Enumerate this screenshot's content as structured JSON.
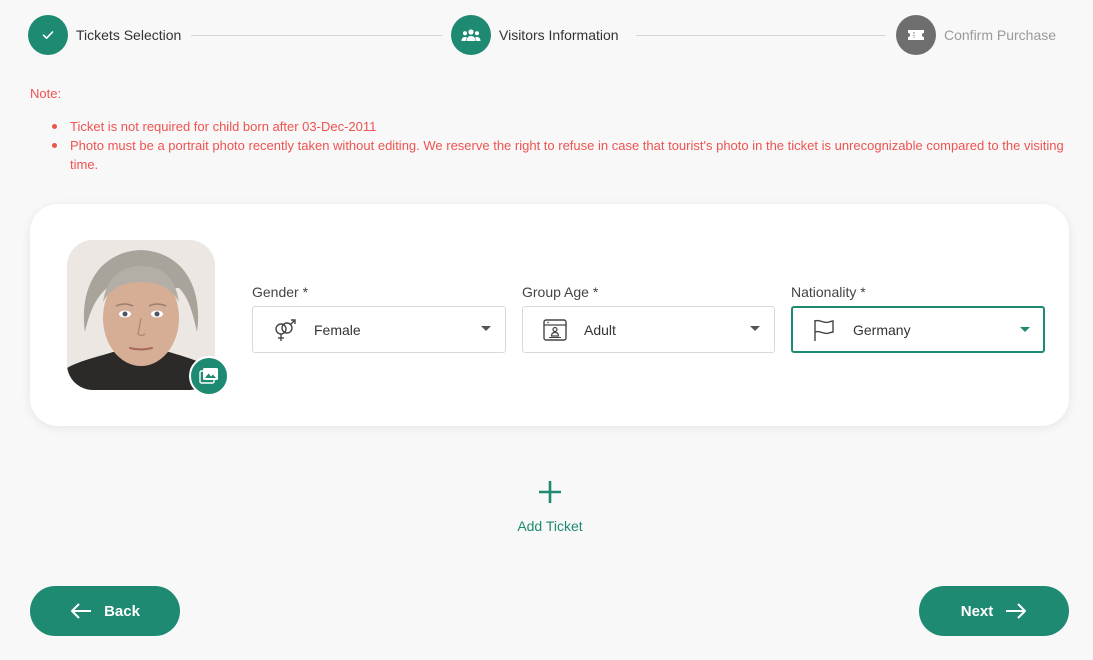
{
  "stepper": {
    "steps": [
      {
        "label": "Tickets Selection",
        "state": "completed",
        "icon": "check-icon"
      },
      {
        "label": "Visitors Information",
        "state": "active",
        "icon": "group-icon"
      },
      {
        "label": "Confirm Purchase",
        "state": "inactive",
        "icon": "ticket-icon"
      }
    ]
  },
  "note": {
    "title": "Note:",
    "items": [
      "Ticket is not required for child born after 03-Dec-2011",
      "Photo must be a portrait photo recently taken without editing. We reserve the right to refuse in case that tourist's photo in the ticket is unrecognizable compared to the visiting time."
    ]
  },
  "visitor": {
    "photo_button_icon": "photo-library-icon",
    "gender": {
      "label": "Gender *",
      "value": "Female",
      "icon": "gender-icon"
    },
    "group_age": {
      "label": "Group Age *",
      "value": "Adult",
      "icon": "id-badge-icon"
    },
    "nationality": {
      "label": "Nationality *",
      "value": "Germany",
      "icon": "flag-icon"
    }
  },
  "add_ticket": {
    "label": "Add Ticket",
    "icon": "plus-icon"
  },
  "buttons": {
    "back": "Back",
    "next": "Next"
  },
  "colors": {
    "accent": "#1e8a72",
    "note": "#ef5350",
    "inactive": "#6e6e6e"
  }
}
